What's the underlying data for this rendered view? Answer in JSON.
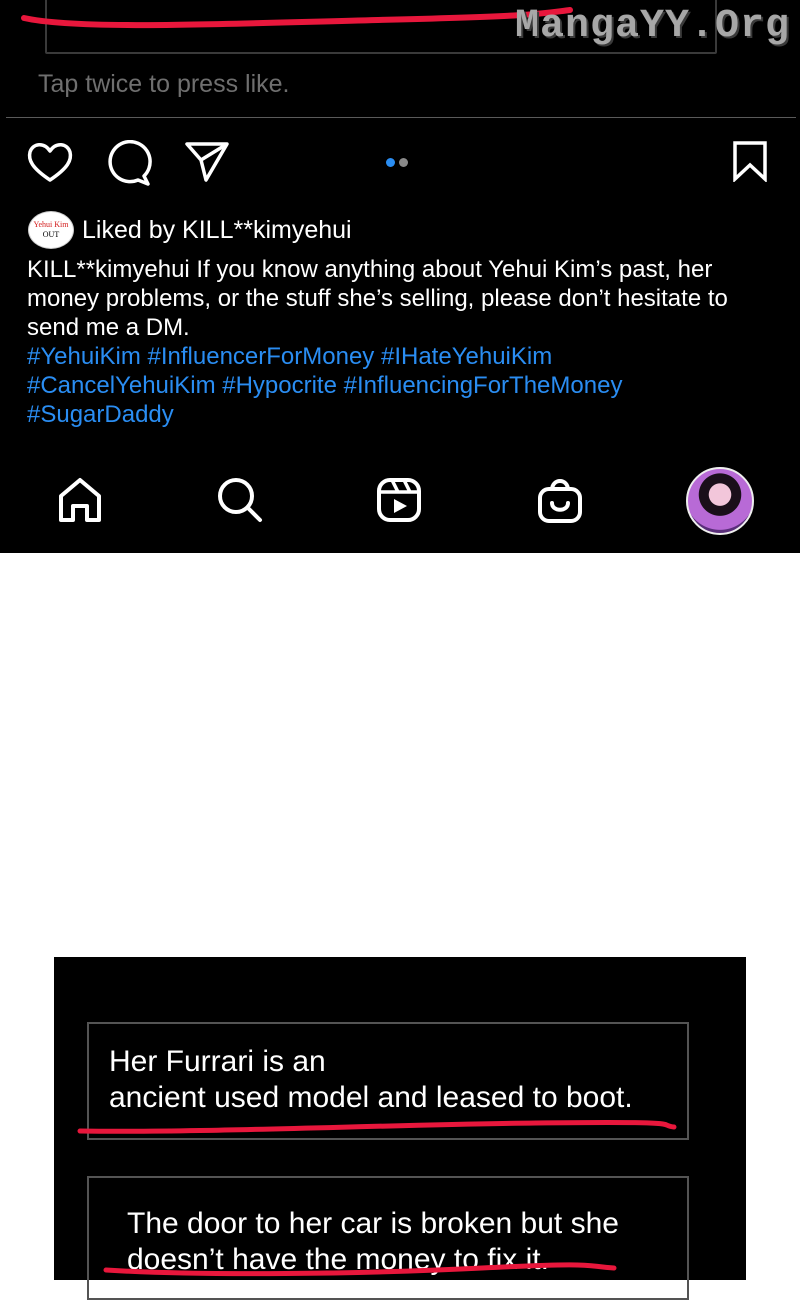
{
  "watermark": "MangaYY.Org",
  "post": {
    "hint": "Tap twice to press like.",
    "liked_by": "Liked by KILL**kimyehui",
    "liked_avatar": {
      "line1": "Yehui Kim",
      "line2": "OUT"
    },
    "caption": {
      "username": "KILL**kimyehui",
      "text": "If you know anything about Yehui Kim’s past, her money problems, or the stuff she’s selling, please don’t hesitate to send me a DM."
    },
    "hashtags": {
      "line1": "#YehuiKim #InfluencerForMoney #IHateYehuiKim",
      "line2": "#CancelYehuiKim #Hypocrite #InfluencingForTheMoney",
      "line3": "#SugarDaddy"
    },
    "icons": {
      "actions": [
        "heart-icon",
        "comment-icon",
        "share-icon",
        "bookmark-icon"
      ],
      "nav": [
        "home-icon",
        "search-icon",
        "reels-icon",
        "shop-icon",
        "profile-avatar"
      ]
    },
    "colors": {
      "hashtag": "#2a8df2",
      "dot_active": "#2a8df2",
      "dot_inactive": "#8a8a8a",
      "underline": "#e8173c"
    }
  },
  "panel": {
    "box1": "Her Furrari is an\nancient used model and leased to boot.",
    "box2": "The door to her car is broken but she\ndoesn’t have the money to fix it."
  }
}
